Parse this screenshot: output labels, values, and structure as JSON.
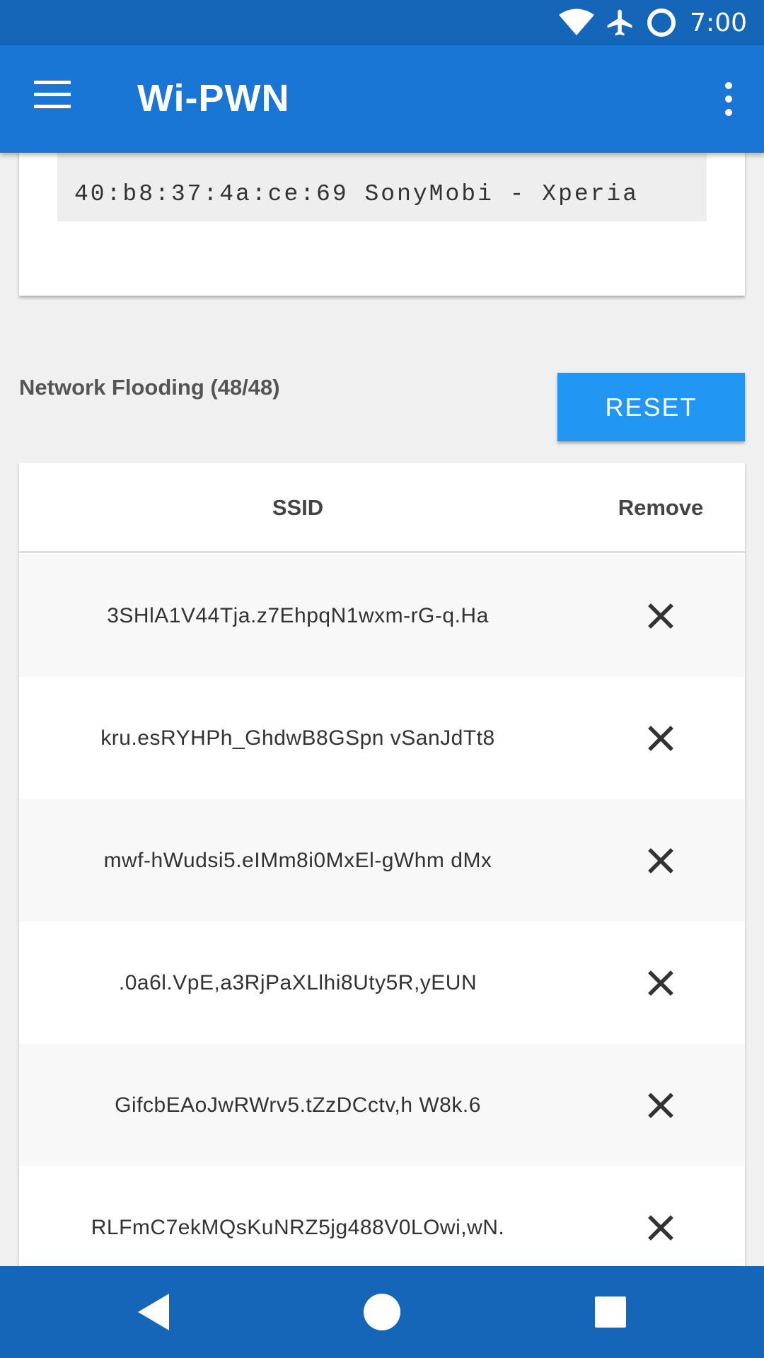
{
  "status_bar": {
    "time": "7:00",
    "icons": [
      "wifi-icon",
      "airplane-icon",
      "circle-icon"
    ]
  },
  "app_bar": {
    "title": "Wi-PWN",
    "icons": [
      "menu-icon",
      "more-vert-icon"
    ]
  },
  "top_card": {
    "partial_line": "...",
    "code_line": "40:b8:37:4a:ce:69 SonyMobi - Xperia"
  },
  "flooding": {
    "title": "Network Flooding (48/48)",
    "reset_label": "RESET"
  },
  "table": {
    "headers": {
      "ssid": "SSID",
      "remove": "Remove"
    },
    "rows": [
      {
        "ssid": "3SHlA1V44Tja.z7EhpqN1wxm-rG-q.Ha"
      },
      {
        "ssid": "kru.esRYHPh_GhdwB8GSpn vSanJdTt8"
      },
      {
        "ssid": "mwf-hWudsi5.eIMm8i0MxEl-gWhm dMx"
      },
      {
        "ssid": ".0a6l.VpE,a3RjPaXLlhi8Uty5R,yEUN"
      },
      {
        "ssid": "GifcbEAoJwRWrv5.tZzDCctv,h W8k.6"
      },
      {
        "ssid": "RLFmC7ekMQsKuNRZ5jg488V0LOwi,wN."
      }
    ]
  },
  "nav_bar": {
    "icons": [
      "back-icon",
      "home-icon",
      "recents-icon"
    ]
  },
  "colors": {
    "status_bar": "#1565b8",
    "app_bar": "#1976d4",
    "accent_button": "#2196f3",
    "background": "#f0f0f0"
  }
}
